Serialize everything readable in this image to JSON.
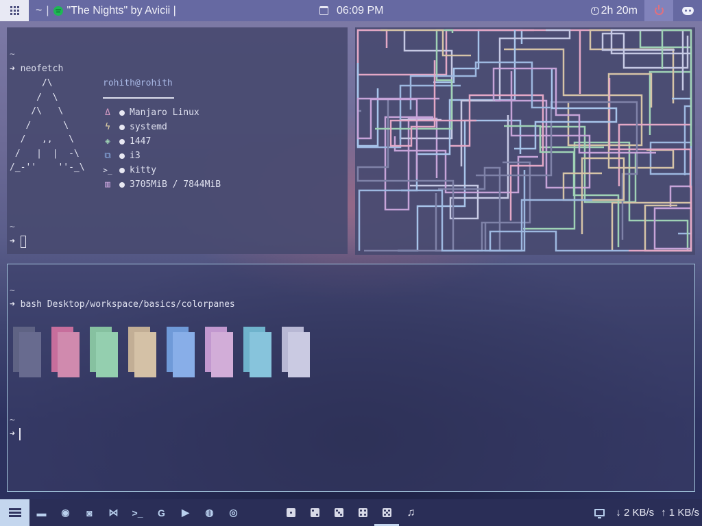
{
  "topbar": {
    "workspace": "~",
    "separator": "|",
    "song": "\"The Nights\" by Avicii |",
    "time": "06:09 PM",
    "uptime": "2h 20m"
  },
  "term1": {
    "tilde_top": "~",
    "prompt_arrow": "➜",
    "command": "neofetch",
    "ascii": "      /\\\n     /  \\\n    /\\   \\\n   /      \\\n  /   ,,   \\\n /   |  |  -\\\n/_-''    ''-_\\",
    "userhost": "rohith@rohith",
    "info": [
      {
        "icon": "linux-icon",
        "value": "Manjaro Linux"
      },
      {
        "icon": "bolt-icon",
        "value": "systemd"
      },
      {
        "icon": "package-icon",
        "value": "1447"
      },
      {
        "icon": "windows-icon",
        "value": "i3"
      },
      {
        "icon": "terminal-icon",
        "value": "kitty"
      },
      {
        "icon": "memory-icon",
        "value": "3705MiB / 7844MiB"
      }
    ],
    "icon_glyphs": [
      "Δ",
      "ϟ",
      "◈",
      "⧉",
      ">_",
      "▥"
    ],
    "tilde_bottom": "~",
    "prompt_bottom": "➜"
  },
  "term3": {
    "tilde_top": "~",
    "prompt_arrow": "➜",
    "command": "bash Desktop/workspace/basics/colorpanes",
    "swatches": [
      {
        "dark": "#5f6384",
        "light": "#686b8f"
      },
      {
        "dark": "#c76e9c",
        "light": "#d08aae"
      },
      {
        "dark": "#86c1a0",
        "light": "#94cfaf"
      },
      {
        "dark": "#c2ae95",
        "light": "#d4c1a6"
      },
      {
        "dark": "#6f9ad8",
        "light": "#88aee8"
      },
      {
        "dark": "#c298cf",
        "light": "#d2add8"
      },
      {
        "dark": "#6fb3cc",
        "light": "#87c4dc"
      },
      {
        "dark": "#b8b8d4",
        "light": "#cacae2"
      }
    ],
    "tilde_bottom": "~",
    "prompt_bottom": "➜"
  },
  "bottombar": {
    "apps": [
      "files-icon",
      "firefox-icon",
      "discord-icon",
      "vscode-icon",
      "terminal-icon",
      "google-icon",
      "youtube-icon",
      "reddit-icon",
      "github-icon"
    ],
    "app_glyphs": [
      "▬",
      "◉",
      "◙",
      "⋈",
      ">_",
      "G",
      "▶",
      "◍",
      "◎"
    ],
    "workspaces": [
      1,
      2,
      3,
      4,
      5
    ],
    "active_workspace": 5,
    "music_glyph": "♫",
    "down_label": "↓ 2 KB/s",
    "up_label": "↑ 1 KB/s"
  },
  "pipes_colors": [
    "#a7c4ea",
    "#c7a4d9",
    "#e4a8c6",
    "#9fd2b5",
    "#d6c4a7",
    "#9db8e0",
    "#7f82a8",
    "#c6c9e4"
  ]
}
